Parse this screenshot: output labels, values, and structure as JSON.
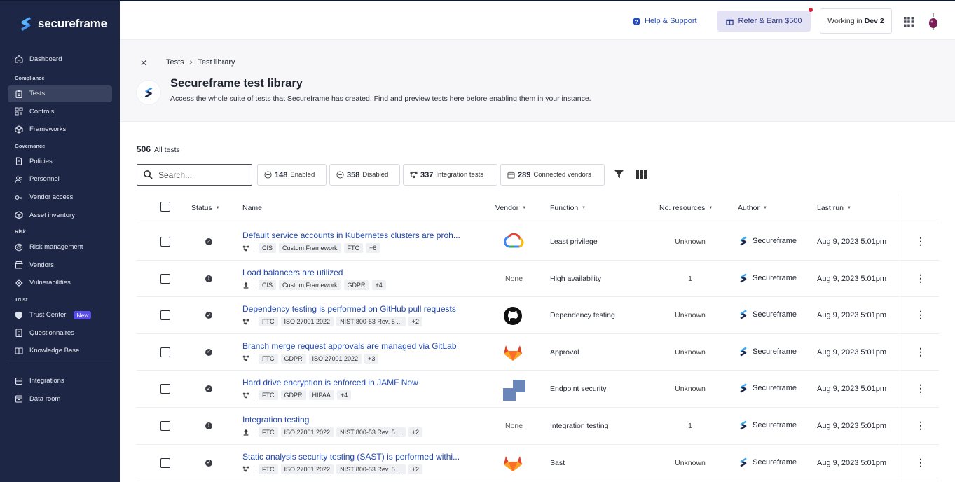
{
  "brand": {
    "name": "secureframe",
    "accent": "#2549b6",
    "sidebar_bg": "#1d2645"
  },
  "sidebar": {
    "sections": [
      {
        "title": "",
        "items": [
          {
            "label": "Dashboard",
            "icon": "home-icon"
          }
        ]
      },
      {
        "title": "Compliance",
        "items": [
          {
            "label": "Tests",
            "icon": "clipboard-icon",
            "active": true
          },
          {
            "label": "Controls",
            "icon": "grid-icon"
          },
          {
            "label": "Frameworks",
            "icon": "cube-icon"
          }
        ]
      },
      {
        "title": "Governance",
        "items": [
          {
            "label": "Policies",
            "icon": "document-icon"
          },
          {
            "label": "Personnel",
            "icon": "users-icon"
          },
          {
            "label": "Vendor access",
            "icon": "key-icon"
          },
          {
            "label": "Asset inventory",
            "icon": "box-icon"
          }
        ]
      },
      {
        "title": "Risk",
        "items": [
          {
            "label": "Risk management",
            "icon": "radar-icon"
          },
          {
            "label": "Vendors",
            "icon": "store-icon"
          },
          {
            "label": "Vulnerabilities",
            "icon": "bug-icon"
          }
        ]
      },
      {
        "title": "Trust",
        "items": [
          {
            "label": "Trust Center",
            "icon": "shield-icon",
            "badge": "New"
          },
          {
            "label": "Questionnaires",
            "icon": "questionnaire-icon"
          },
          {
            "label": "Knowledge Base",
            "icon": "book-icon"
          }
        ]
      }
    ],
    "bottom_items": [
      {
        "label": "Integrations",
        "icon": "plug-icon"
      },
      {
        "label": "Data room",
        "icon": "archive-icon"
      }
    ]
  },
  "topbar": {
    "help_label": "Help & Support",
    "refer_label": "Refer & Earn $500",
    "working_prefix": "Working in",
    "workspace": "Dev 2"
  },
  "header": {
    "breadcrumb": [
      "Tests",
      "Test library"
    ],
    "title": "Secureframe test library",
    "subtitle": "Access the whole suite of tests that Secureframe has created. Find and preview tests here before enabling them in your instance."
  },
  "summary": {
    "count": "506",
    "label": "All tests"
  },
  "search": {
    "placeholder": "Search..."
  },
  "chips": [
    {
      "count": "148",
      "label": "Enabled",
      "icon": "plus-circle-icon"
    },
    {
      "count": "358",
      "label": "Disabled",
      "icon": "minus-circle-icon"
    },
    {
      "count": "337",
      "label": "Integration tests",
      "icon": "integration-icon"
    },
    {
      "count": "289",
      "label": "Connected vendors",
      "icon": "vendor-icon"
    }
  ],
  "table": {
    "columns": [
      "Status",
      "Name",
      "Vendor",
      "Function",
      "No. resources",
      "Author",
      "Last run"
    ],
    "rows": [
      {
        "status": "pass",
        "name": "Default service accounts in Kubernetes clusters are proh...",
        "type": "integration",
        "tags": [
          "CIS",
          "Custom Framework",
          "FTC",
          "+6"
        ],
        "vendor": "gcp",
        "vendor_text": "",
        "function": "Least privilege",
        "resources": "Unknown",
        "author": "Secureframe",
        "last_run": "Aug 9, 2023 5:01pm"
      },
      {
        "status": "info",
        "name": "Load balancers are utilized",
        "type": "upload",
        "tags": [
          "CIS",
          "Custom Framework",
          "GDPR",
          "+4"
        ],
        "vendor": "none",
        "vendor_text": "None",
        "function": "High availability",
        "resources": "1",
        "author": "Secureframe",
        "last_run": "Aug 9, 2023 5:01pm"
      },
      {
        "status": "pass",
        "name": "Dependency testing is performed on GitHub pull requests",
        "type": "integration",
        "tags": [
          "FTC",
          "ISO 27001 2022",
          "NIST 800-53 Rev. 5 ...",
          "+2"
        ],
        "vendor": "github",
        "vendor_text": "",
        "function": "Dependency testing",
        "resources": "Unknown",
        "author": "Secureframe",
        "last_run": "Aug 9, 2023 5:01pm"
      },
      {
        "status": "pass",
        "name": "Branch merge request approvals are managed via GitLab",
        "type": "integration",
        "tags": [
          "FTC",
          "GDPR",
          "ISO 27001 2022",
          "+3"
        ],
        "vendor": "gitlab",
        "vendor_text": "",
        "function": "Approval",
        "resources": "Unknown",
        "author": "Secureframe",
        "last_run": "Aug 9, 2023 5:01pm"
      },
      {
        "status": "pass",
        "name": "Hard drive encryption is enforced in JAMF Now",
        "type": "integration",
        "tags": [
          "FTC",
          "GDPR",
          "HIPAA",
          "+4"
        ],
        "vendor": "jamf",
        "vendor_text": "",
        "function": "Endpoint security",
        "resources": "Unknown",
        "author": "Secureframe",
        "last_run": "Aug 9, 2023 5:01pm"
      },
      {
        "status": "info",
        "name": "Integration testing",
        "type": "upload",
        "tags": [
          "FTC",
          "ISO 27001 2022",
          "NIST 800-53 Rev. 5 ...",
          "+2"
        ],
        "vendor": "none",
        "vendor_text": "None",
        "function": "Integration testing",
        "resources": "1",
        "author": "Secureframe",
        "last_run": "Aug 9, 2023 5:01pm"
      },
      {
        "status": "pass",
        "name": "Static analysis security testing (SAST) is performed withi...",
        "type": "integration",
        "tags": [
          "FTC",
          "ISO 27001 2022",
          "NIST 800-53 Rev. 5 ...",
          "+2"
        ],
        "vendor": "gitlab",
        "vendor_text": "",
        "function": "Sast",
        "resources": "Unknown",
        "author": "Secureframe",
        "last_run": "Aug 9, 2023 5:01pm"
      }
    ]
  }
}
